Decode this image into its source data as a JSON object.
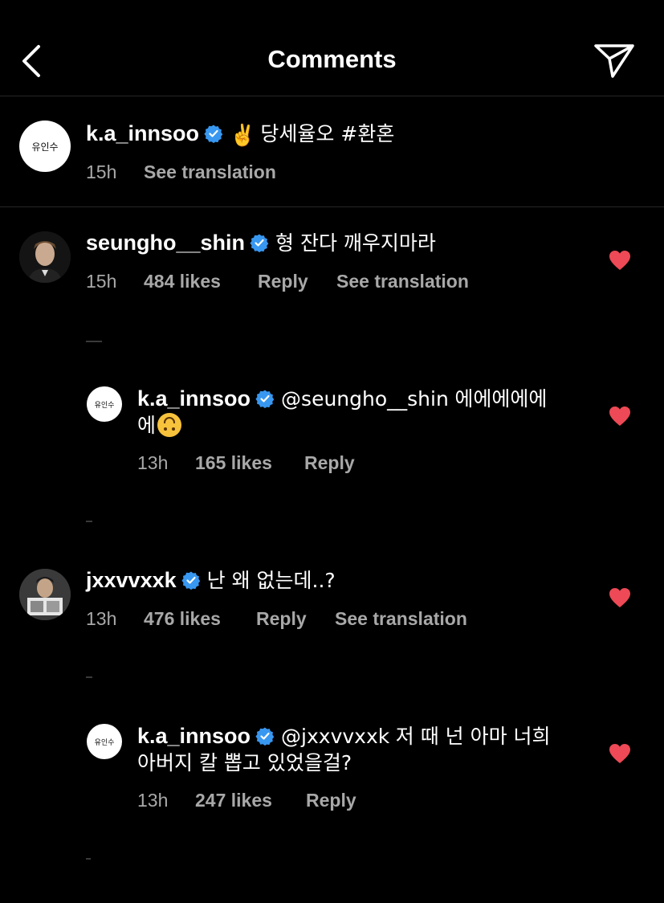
{
  "header": {
    "title": "Comments"
  },
  "caption": {
    "avatar_text": "유인수",
    "username": "k.a_innsoo",
    "text": "당세율오 #환혼",
    "emoji": "✌️",
    "time": "15h",
    "see_translation": "See translation"
  },
  "comments": [
    {
      "username": "seungho__shin",
      "text": "형 잔다 깨우지마라",
      "time": "15h",
      "likes": "484 likes",
      "reply": "Reply",
      "see_translation": "See translation"
    },
    {
      "avatar_text": "유인수",
      "username": "k.a_innsoo",
      "mention": "@seungho__shin",
      "text_line1": "에에에에에",
      "text_line2": "에",
      "time": "13h",
      "likes": "165 likes",
      "reply": "Reply"
    },
    {
      "username": "jxxvvxxk",
      "text": "난 왜 없는데..?",
      "time": "13h",
      "likes": "476 likes",
      "reply": "Reply",
      "see_translation": "See translation"
    },
    {
      "avatar_text": "유인수",
      "username": "k.a_innsoo",
      "mention": "@jxxvvxxk",
      "text_line1": "저 때 넌 아마 너희",
      "text_line2": "아버지 칼 뽑고 있었을걸?",
      "time": "13h",
      "likes": "247 likes",
      "reply": "Reply"
    }
  ],
  "colors": {
    "background": "#000000",
    "text": "#ffffff",
    "meta": "#a8a8a8",
    "verified": "#3897f0",
    "heart": "#ed4956"
  }
}
